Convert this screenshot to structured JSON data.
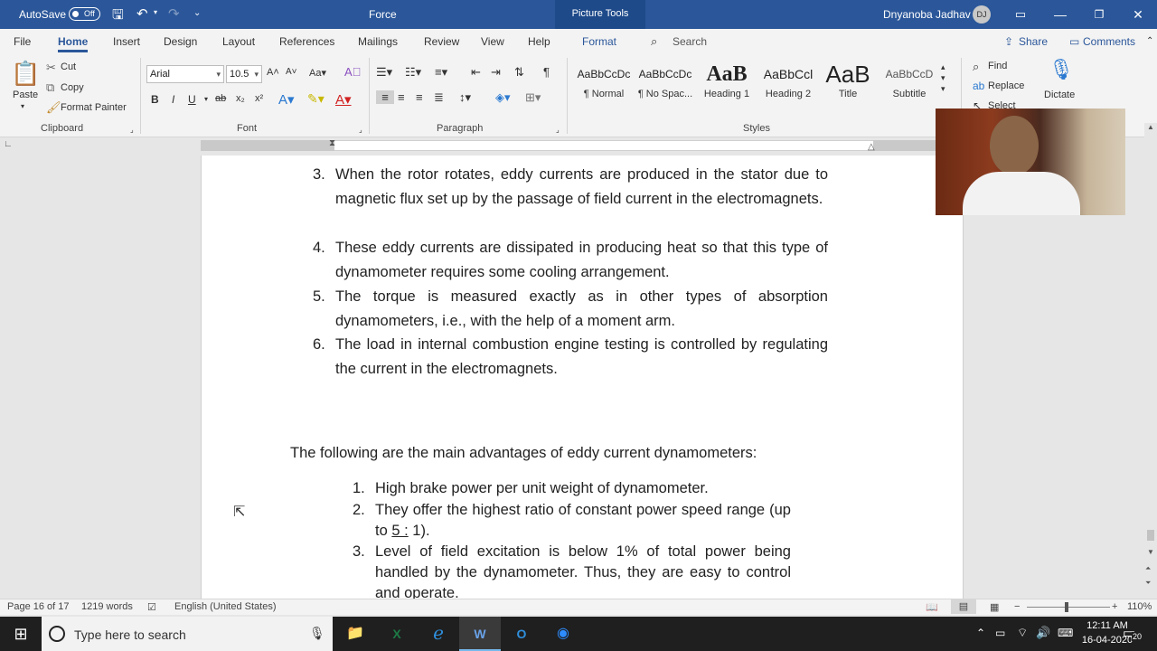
{
  "titlebar": {
    "autosave_label": "AutoSave",
    "autosave_state": "Off",
    "document_title": "Force",
    "picture_tools": "Picture Tools",
    "user_name": "Dnyanoba Jadhav",
    "user_initials": "DJ"
  },
  "menu": {
    "tabs": [
      "File",
      "Home",
      "Insert",
      "Design",
      "Layout",
      "References",
      "Mailings",
      "Review",
      "View",
      "Help",
      "Format"
    ],
    "search_placeholder": "Search",
    "share_label": "Share",
    "comments_label": "Comments"
  },
  "ribbon": {
    "clipboard": {
      "paste": "Paste",
      "cut": "Cut",
      "copy": "Copy",
      "format_painter": "Format Painter",
      "label": "Clipboard"
    },
    "font": {
      "font_name": "Arial",
      "font_size": "10.5",
      "label": "Font"
    },
    "paragraph": {
      "label": "Paragraph"
    },
    "styles": {
      "items": [
        {
          "preview": "AaBbCcDc",
          "name": "¶ Normal"
        },
        {
          "preview": "AaBbCcDc",
          "name": "¶ No Spac..."
        },
        {
          "preview": "AaB",
          "name": "Heading 1"
        },
        {
          "preview": "AaBbCcl",
          "name": "Heading 2"
        },
        {
          "preview": "AaB",
          "name": "Title"
        },
        {
          "preview": "AaBbCcD",
          "name": "Subtitle"
        }
      ],
      "label": "Styles"
    },
    "editing": {
      "find": "Find",
      "replace": "Replace",
      "select": "Select"
    },
    "voice": {
      "dictate": "Dictate"
    }
  },
  "document": {
    "list1": [
      {
        "num": "3.",
        "text": "When the rotor rotates, eddy currents are produced in the stator due to magnetic flux set up by the passage of field current in the electromagnets."
      },
      {
        "num": "4.",
        "text": "These eddy currents are dissipated in producing heat so that this type of dynamometer requires some cooling arrangement."
      },
      {
        "num": "5.",
        "text": "The torque is measured exactly as in other types of absorption dynamometers, i.e., with the help of a moment arm."
      },
      {
        "num": "6.",
        "text": "The load in internal combustion engine testing is controlled by regulating the current in the electromagnets."
      }
    ],
    "advantages_heading": "The following are the main advantages of eddy current dynamometers:",
    "list2": [
      {
        "num": "1.",
        "text": "High brake power per unit weight of dynamometer."
      },
      {
        "num": "2.",
        "text_before": "They offer the highest ratio of constant power speed range (up to ",
        "underlined": "5 :",
        "text_after": " 1)."
      },
      {
        "num": "3.",
        "text": "Level of field excitation is below 1% of total power being handled by the dynamometer. Thus, they are easy to control and operate."
      }
    ]
  },
  "statusbar": {
    "page": "Page 16 of 17",
    "words": "1219 words",
    "language": "English (United States)",
    "zoom": "110%"
  },
  "taskbar": {
    "search_placeholder": "Type here to search",
    "time": "12:11 AM",
    "date": "16-04-2020",
    "notifications": "20"
  }
}
